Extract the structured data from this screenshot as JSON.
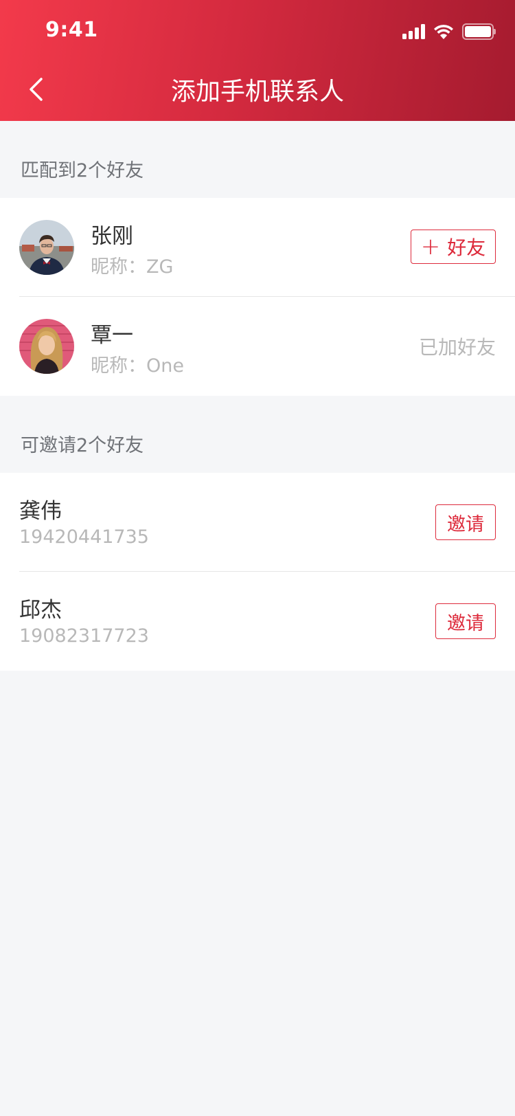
{
  "status_bar": {
    "time": "9:41"
  },
  "header": {
    "title": "添加手机联系人"
  },
  "matched": {
    "label": "匹配到2个好友",
    "contacts": [
      {
        "name": "张刚",
        "nickname": "昵称：ZG",
        "action_plus": "+",
        "action_label": "好友"
      },
      {
        "name": "覃一",
        "nickname": "昵称：One",
        "status": "已加好友"
      }
    ]
  },
  "invitable": {
    "label": "可邀请2个好友",
    "contacts": [
      {
        "name": "龚伟",
        "phone": "19420441735",
        "action_label": "邀请"
      },
      {
        "name": "邱杰",
        "phone": "19082317723",
        "action_label": "邀请"
      }
    ]
  },
  "colors": {
    "accent": "#dd2a3b",
    "header_gradient_start": "#f33a4b",
    "header_gradient_end": "#a51b2f",
    "background": "#f5f6f8"
  },
  "icons": {
    "back": "chevron-left-icon",
    "signal": "cellular-signal-icon",
    "wifi": "wifi-icon",
    "battery": "battery-icon"
  }
}
